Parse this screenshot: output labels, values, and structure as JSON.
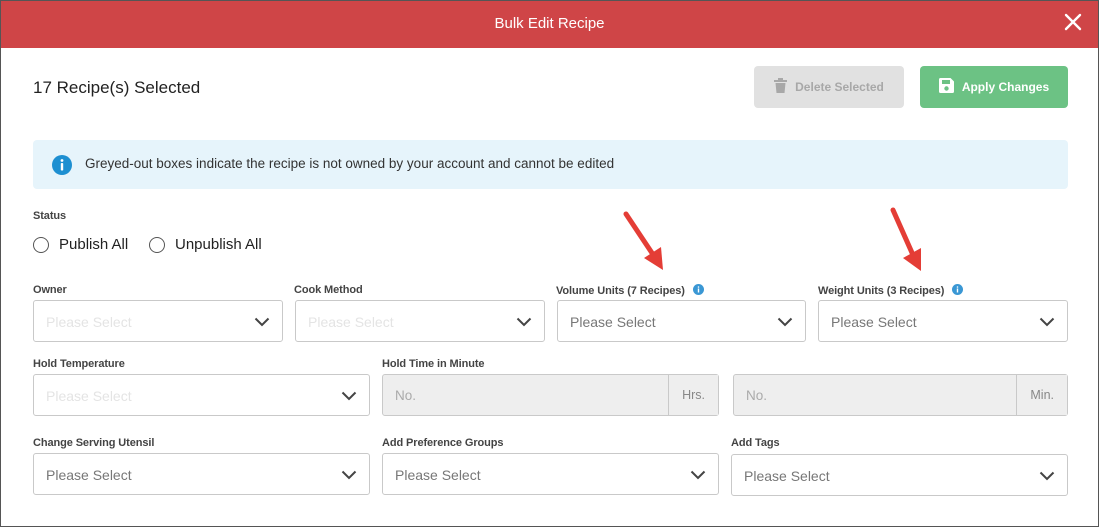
{
  "header": {
    "title": "Bulk Edit Recipe",
    "close_icon": "close-icon"
  },
  "toolbar": {
    "selected_count": "17 Recipe(s) Selected",
    "delete_label": "Delete Selected",
    "apply_label": "Apply Changes"
  },
  "notice": {
    "text": "Greyed-out boxes indicate the recipe is not owned by your account and cannot be edited",
    "icon": "info-icon"
  },
  "status": {
    "label": "Status",
    "options": [
      "Publish All",
      "Unpublish All"
    ]
  },
  "fields": {
    "owner": {
      "label": "Owner",
      "placeholder": "Please Select"
    },
    "cook_method": {
      "label": "Cook Method",
      "placeholder": "Please Select"
    },
    "volume_units": {
      "label": "Volume Units (7 Recipes)",
      "placeholder": "Please Select"
    },
    "weight_units": {
      "label": "Weight Units (3 Recipes)",
      "placeholder": "Please Select"
    },
    "hold_temperature": {
      "label": "Hold Temperature",
      "placeholder": "Please Select"
    },
    "hold_time": {
      "label": "Hold Time in Minute",
      "hours_placeholder": "No.",
      "hours_unit": "Hrs.",
      "minutes_placeholder": "No.",
      "minutes_unit": "Min."
    },
    "serving_utensil": {
      "label": "Change Serving Utensil",
      "placeholder": "Please Select"
    },
    "preference_groups": {
      "label": "Add Preference Groups",
      "placeholder": "Please Select"
    },
    "tags": {
      "label": "Add Tags",
      "placeholder": "Please Select"
    }
  },
  "colors": {
    "header": "#cf4547",
    "apply": "#6cc284",
    "info_bg": "#e6f4fb",
    "info_icon": "#1d8fd1",
    "arrow": "#e43d36"
  }
}
